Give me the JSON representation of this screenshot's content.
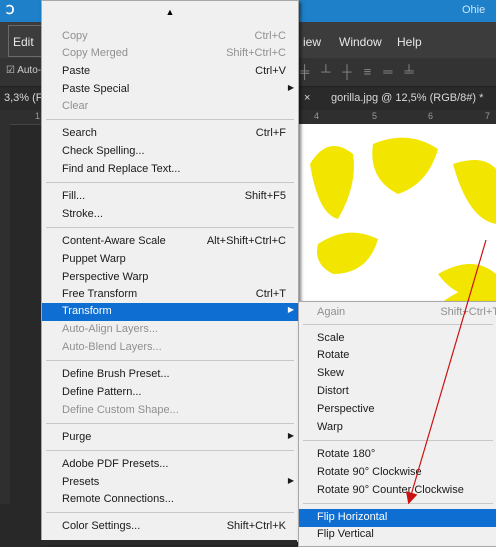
{
  "window": {
    "title": "Ohie"
  },
  "menubar": {
    "edit": "Edit",
    "view": "iew",
    "window": "Window",
    "help": "Help"
  },
  "optionsbar": {
    "auto_select": "Auto-S"
  },
  "tabs": {
    "left_tab": "3,3% (F",
    "active_tab": "gorilla.jpg @ 12,5% (RGB/8#) *",
    "close": "×"
  },
  "ruler": {
    "marks": [
      "1",
      "4",
      "5",
      "6",
      "7"
    ]
  },
  "edit_menu": {
    "scroll_up": "▲",
    "items": [
      {
        "label": "Copy",
        "shortcut": "Ctrl+C",
        "disabled": true
      },
      {
        "label": "Copy Merged",
        "shortcut": "Shift+Ctrl+C",
        "disabled": true
      },
      {
        "label": "Paste",
        "shortcut": "Ctrl+V"
      },
      {
        "label": "Paste Special",
        "submenu": true
      },
      {
        "label": "Clear",
        "disabled": true
      },
      {
        "label": "Search",
        "shortcut": "Ctrl+F"
      },
      {
        "label": "Check Spelling..."
      },
      {
        "label": "Find and Replace Text..."
      },
      {
        "label": "Fill...",
        "shortcut": "Shift+F5"
      },
      {
        "label": "Stroke..."
      },
      {
        "label": "Content-Aware Scale",
        "shortcut": "Alt+Shift+Ctrl+C"
      },
      {
        "label": "Puppet Warp"
      },
      {
        "label": "Perspective Warp"
      },
      {
        "label": "Free Transform",
        "shortcut": "Ctrl+T"
      },
      {
        "label": "Transform",
        "submenu": true,
        "highlighted": true
      },
      {
        "label": "Auto-Align Layers...",
        "disabled": true
      },
      {
        "label": "Auto-Blend Layers...",
        "disabled": true
      },
      {
        "label": "Define Brush Preset..."
      },
      {
        "label": "Define Pattern..."
      },
      {
        "label": "Define Custom Shape...",
        "disabled": true
      },
      {
        "label": "Purge",
        "submenu": true
      },
      {
        "label": "Adobe PDF Presets..."
      },
      {
        "label": "Presets",
        "submenu": true
      },
      {
        "label": "Remote Connections..."
      },
      {
        "label": "Color Settings...",
        "shortcut": "Shift+Ctrl+K"
      }
    ]
  },
  "transform_menu": {
    "items": [
      {
        "label": "Again",
        "shortcut": "Shift+Ctrl+T",
        "disabled": true
      },
      {
        "label": "Scale"
      },
      {
        "label": "Rotate"
      },
      {
        "label": "Skew"
      },
      {
        "label": "Distort"
      },
      {
        "label": "Perspective"
      },
      {
        "label": "Warp"
      },
      {
        "label": "Rotate 180°"
      },
      {
        "label": "Rotate 90° Clockwise"
      },
      {
        "label": "Rotate 90° Counter Clockwise"
      },
      {
        "label": "Flip Horizontal",
        "highlighted": true
      },
      {
        "label": "Flip Vertical"
      }
    ]
  },
  "colors": {
    "highlight": "#0f6ed1",
    "annotation_arrow": "#cc1111",
    "sun": "#f2e600"
  }
}
